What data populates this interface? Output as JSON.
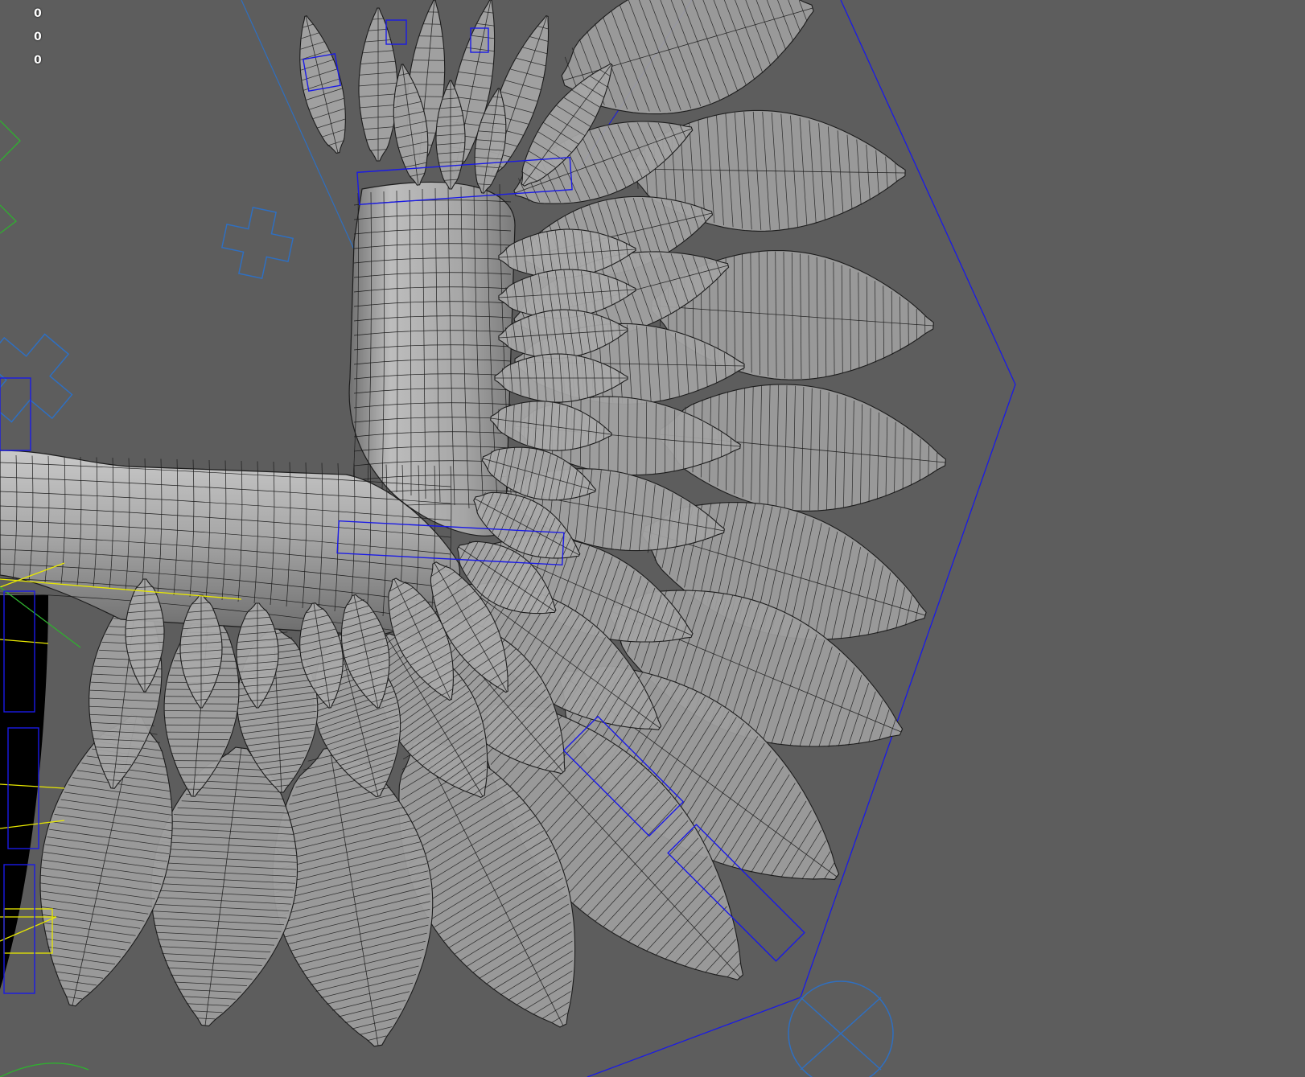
{
  "viewport": {
    "background_color": "#5d5d5d",
    "hud_values": [
      "0",
      "0",
      "0"
    ]
  },
  "scene": {
    "mesh_fill": "#a0a0a0",
    "mesh_shade": "#8a8a8a",
    "wire_color": "#1c1c1c",
    "rig_blue": "#1a1ae6",
    "rig_light_blue": "#2f6fc0",
    "rig_yellow": "#e8e800",
    "rig_green": "#2fb02f",
    "body_black": "#000000"
  }
}
